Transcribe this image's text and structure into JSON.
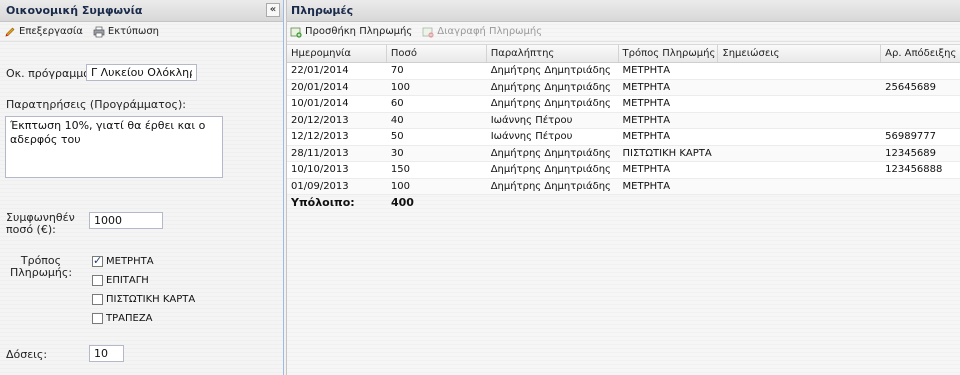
{
  "left": {
    "title": "Οικονομική Συμφωνία",
    "collapse_glyph": "«",
    "toolbar": {
      "edit_label": "Επεξεργασία",
      "print_label": "Εκτύπωση"
    },
    "program": {
      "label": "Οκ. πρόγραμμα:",
      "value": "Γ Λυκείου Ολόκληρο"
    },
    "notes": {
      "label": "Παρατηρήσεις (Προγράμματος):",
      "value": "Έκπτωση 10%, γιατί θα έρθει και ο αδερφός του"
    },
    "agreed_amount": {
      "label_line1": "Συμφωνηθέν",
      "label_line2": "ποσό (€):",
      "value": "1000"
    },
    "payment_method": {
      "label_line1": "Τρόπος",
      "label_line2": "Πληρωμής:",
      "options": [
        {
          "label": "ΜΕΤΡΗΤΑ",
          "checked": true
        },
        {
          "label": "ΕΠΙΤΑΓΗ",
          "checked": false
        },
        {
          "label": "ΠΙΣΤΩΤΙΚΗ ΚΑΡΤΑ",
          "checked": false
        },
        {
          "label": "ΤΡΑΠΕΖΑ",
          "checked": false
        }
      ]
    },
    "installments": {
      "label": "Δόσεις:",
      "value": "10"
    }
  },
  "right": {
    "title": "Πληρωμές",
    "toolbar": {
      "add_label": "Προσθήκη Πληρωμής",
      "delete_label": "Διαγραφή Πληρωμής"
    },
    "columns": [
      "Ημερομηνία",
      "Ποσό",
      "Παραλήπτης",
      "Τρόπος Πληρωμής",
      "Σημειώσεις",
      "Αρ. Απόδειξης"
    ],
    "rows": [
      [
        "22/01/2014",
        "70",
        "Δημήτρης Δημητριάδης",
        "ΜΕΤΡΗΤΑ",
        "",
        ""
      ],
      [
        "20/01/2014",
        "100",
        "Δημήτρης Δημητριάδης",
        "ΜΕΤΡΗΤΑ",
        "",
        "25645689"
      ],
      [
        "10/01/2014",
        "60",
        "Δημήτρης Δημητριάδης",
        "ΜΕΤΡΗΤΑ",
        "",
        ""
      ],
      [
        "20/12/2013",
        "40",
        "Ιωάννης Πέτρου",
        "ΜΕΤΡΗΤΑ",
        "",
        ""
      ],
      [
        "12/12/2013",
        "50",
        "Ιωάννης Πέτρου",
        "ΜΕΤΡΗΤΑ",
        "",
        "56989777"
      ],
      [
        "28/11/2013",
        "30",
        "Δημήτρης Δημητριάδης",
        "ΠΙΣΤΩΤΙΚΗ ΚΑΡΤΑ",
        "",
        "12345689"
      ],
      [
        "10/10/2013",
        "150",
        "Δημήτρης Δημητριάδης",
        "ΜΕΤΡΗΤΑ",
        "",
        "123456888"
      ],
      [
        "01/09/2013",
        "100",
        "Δημήτρης Δημητριάδης",
        "ΜΕΤΡΗΤΑ",
        "",
        ""
      ]
    ],
    "balance_label": "Υπόλοιπο:",
    "balance_value": "400"
  }
}
